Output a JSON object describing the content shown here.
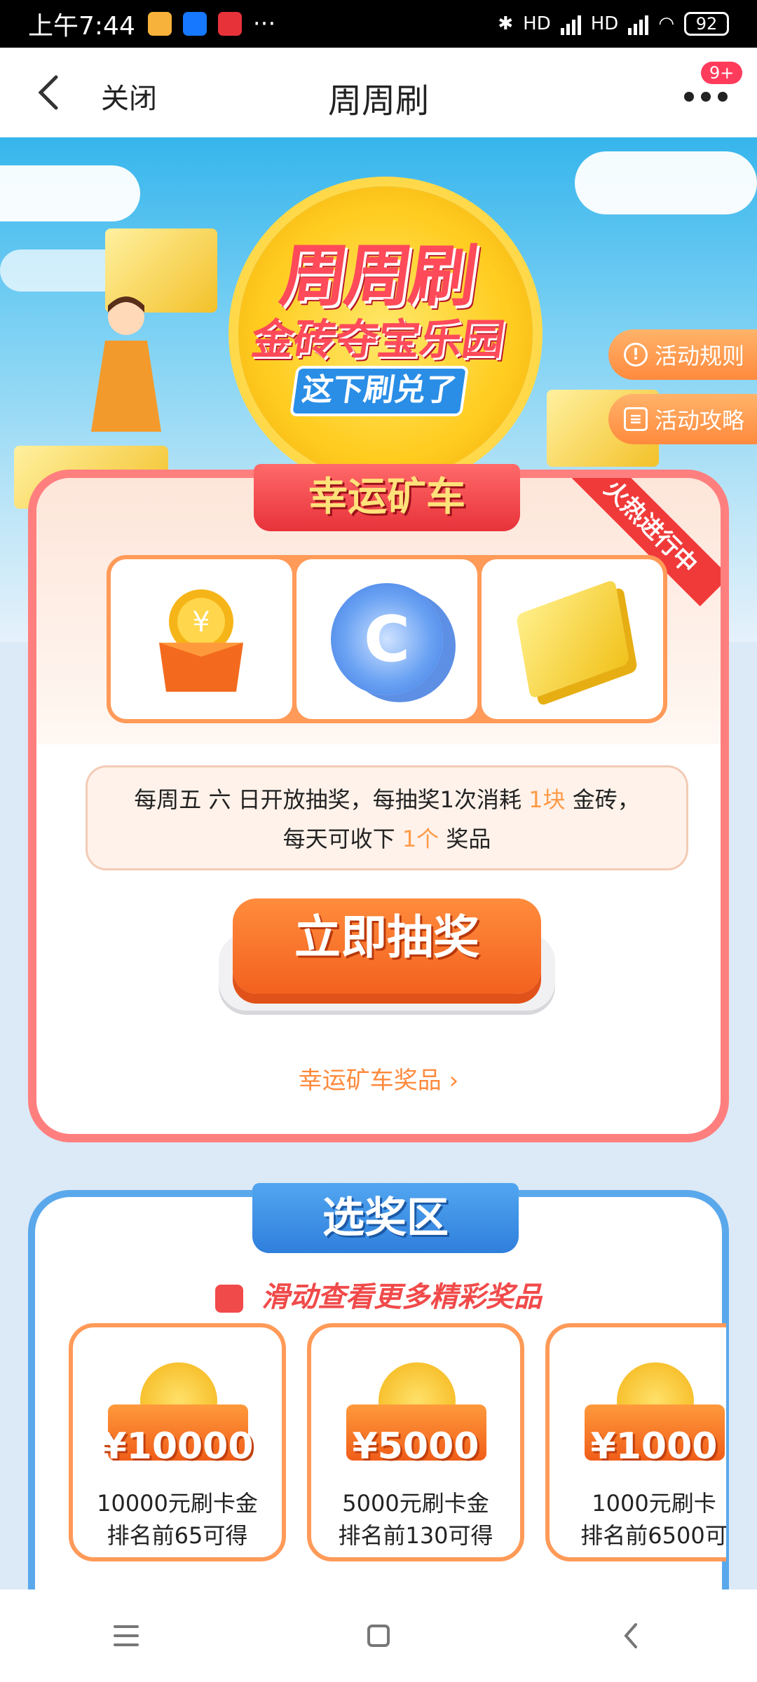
{
  "status_bar": {
    "time": "上午7:44",
    "dots": "···",
    "hd1": "HD",
    "hd2": "HD",
    "battery": "92"
  },
  "nav": {
    "close_label": "关闭",
    "title": "周周刷",
    "badge": "9+"
  },
  "hero": {
    "logo_line1": "周周刷",
    "logo_line2": "金砖夺宝乐园",
    "slogan": "这下刷兑了",
    "rules_label": "活动规则",
    "guide_label": "活动攻略"
  },
  "lucky_cart": {
    "title": "幸运矿车",
    "ribbon": "火热进行中",
    "notice_line1_a": "每周五 六 日开放抽奖，每抽奖1次消耗 ",
    "notice_line1_hl": "1块",
    "notice_line1_b": " 金砖，",
    "notice_line2_a": "每天可收下 ",
    "notice_line2_hl": "1个",
    "notice_line2_b": " 奖品",
    "draw_button": "立即抽奖",
    "prize_link": "幸运矿车奖品"
  },
  "select_area": {
    "title": "选奖区",
    "swipe_hint": "滑动查看更多精彩奖品",
    "prizes": [
      {
        "amount": "¥10000",
        "line1": "10000元刷卡金",
        "line2": "排名前65可得"
      },
      {
        "amount": "¥5000",
        "line1": "5000元刷卡金",
        "line2": "排名前130可得"
      },
      {
        "amount": "¥1000",
        "line1": "1000元刷卡",
        "line2": "排名前6500可"
      }
    ]
  },
  "colors": {
    "accent_orange": "#ff8a3d",
    "card_red_border": "#ff7f7f",
    "card_blue_border": "#5aa8ec",
    "highlight": "#ff9b48"
  }
}
